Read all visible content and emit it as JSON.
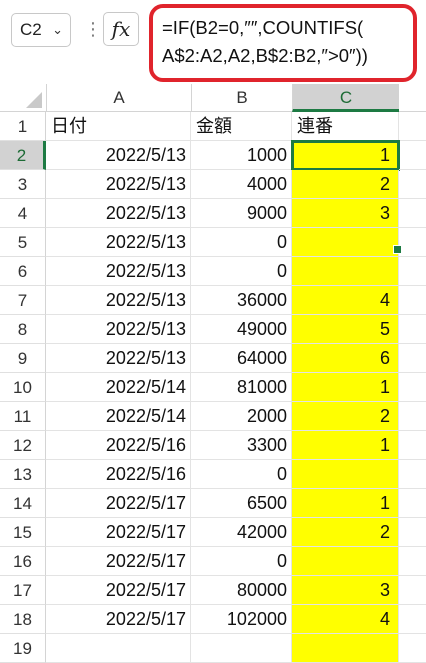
{
  "formula_bar": {
    "name_box": "C2",
    "fx_label": "fx",
    "formula_line1": "=IF(B2=0,″″,COUNTIFS(",
    "formula_line2": "A$2:A2,A2,B$2:B2,″>0″))"
  },
  "columns": [
    "A",
    "B",
    "C"
  ],
  "headers": {
    "row": "1",
    "a": "日付",
    "b": "金額",
    "c": "連番"
  },
  "rows": [
    {
      "n": "2",
      "date": "2022/5/13",
      "amount": "1000",
      "seq": "1"
    },
    {
      "n": "3",
      "date": "2022/5/13",
      "amount": "4000",
      "seq": "2"
    },
    {
      "n": "4",
      "date": "2022/5/13",
      "amount": "9000",
      "seq": "3"
    },
    {
      "n": "5",
      "date": "2022/5/13",
      "amount": "0",
      "seq": ""
    },
    {
      "n": "6",
      "date": "2022/5/13",
      "amount": "0",
      "seq": ""
    },
    {
      "n": "7",
      "date": "2022/5/13",
      "amount": "36000",
      "seq": "4"
    },
    {
      "n": "8",
      "date": "2022/5/13",
      "amount": "49000",
      "seq": "5"
    },
    {
      "n": "9",
      "date": "2022/5/13",
      "amount": "64000",
      "seq": "6"
    },
    {
      "n": "10",
      "date": "2022/5/14",
      "amount": "81000",
      "seq": "1"
    },
    {
      "n": "11",
      "date": "2022/5/14",
      "amount": "2000",
      "seq": "2"
    },
    {
      "n": "12",
      "date": "2022/5/16",
      "amount": "3300",
      "seq": "1"
    },
    {
      "n": "13",
      "date": "2022/5/16",
      "amount": "0",
      "seq": ""
    },
    {
      "n": "14",
      "date": "2022/5/17",
      "amount": "6500",
      "seq": "1"
    },
    {
      "n": "15",
      "date": "2022/5/17",
      "amount": "42000",
      "seq": "2"
    },
    {
      "n": "16",
      "date": "2022/5/17",
      "amount": "0",
      "seq": ""
    },
    {
      "n": "17",
      "date": "2022/5/17",
      "amount": "80000",
      "seq": "3"
    },
    {
      "n": "18",
      "date": "2022/5/17",
      "amount": "102000",
      "seq": "4"
    }
  ],
  "last_row": "19",
  "colors": {
    "highlight": "#ffff00",
    "selection": "#1d7a43",
    "formula_border": "#e0242c"
  }
}
